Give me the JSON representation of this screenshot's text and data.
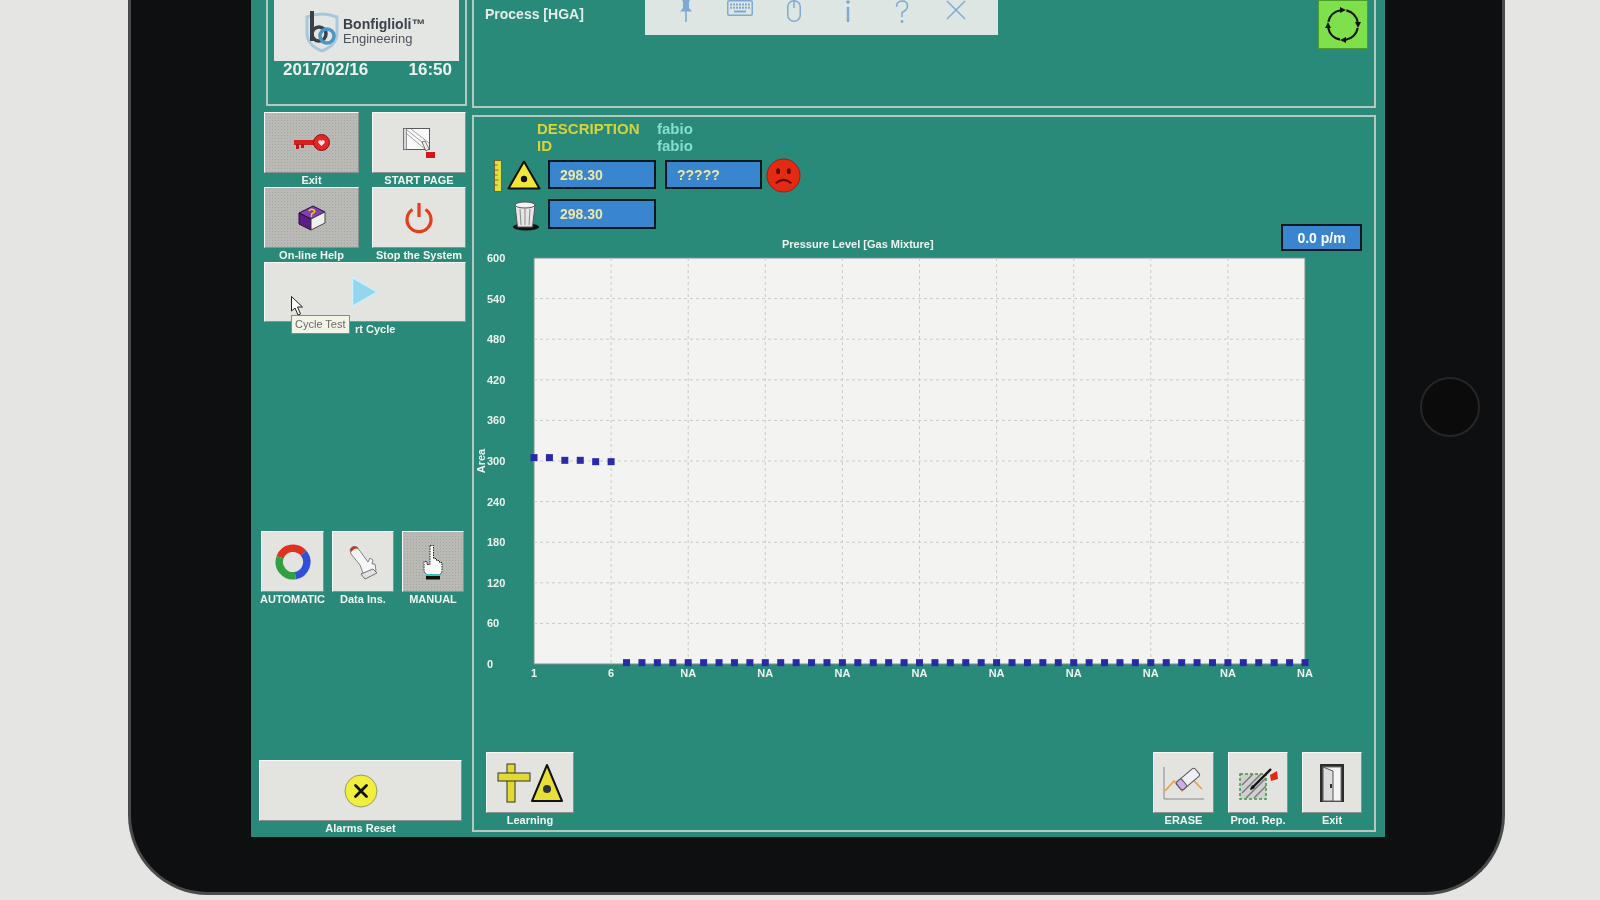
{
  "logo": {
    "name": "Bonfiglioli™",
    "subtitle": "Engineering"
  },
  "clock": {
    "date": "2017/02/16",
    "time": "16:50"
  },
  "menu": [
    {
      "kind": "tile",
      "label": "Exit",
      "disabled": true
    },
    {
      "kind": "tile",
      "label": "START PAGE",
      "disabled": false
    },
    {
      "kind": "tile",
      "label": "On-line Help",
      "disabled": true
    },
    {
      "kind": "tile",
      "label": "Stop the System",
      "disabled": false
    },
    {
      "kind": "wide",
      "label": "rt Cycle",
      "disabled": false,
      "tooltip": "Cycle Test"
    }
  ],
  "modes": [
    {
      "label": "AUTOMATIC",
      "selected": false
    },
    {
      "label": "Data Ins.",
      "selected": false
    },
    {
      "label": "MANUAL",
      "selected": true
    }
  ],
  "alarms_reset": {
    "label": "Alarms Reset"
  },
  "header": {
    "title": "Process [HGA]"
  },
  "description": [
    {
      "label": "DESCRIPTION",
      "value": "fabio"
    },
    {
      "label": "ID",
      "value": "fabio"
    }
  ],
  "measurements": [
    {
      "fields": [
        "298.30",
        "?????"
      ],
      "fault": true
    },
    {
      "fields": [
        "298.30"
      ]
    }
  ],
  "chart": {
    "readout": "0.0 p/m",
    "chart_data": {
      "type": "scatter",
      "title": "Pressure Level [Gas Mixture]",
      "ylabel": "Area",
      "grid": true,
      "x": [
        1,
        2,
        3,
        4,
        5,
        6,
        7,
        8,
        9,
        10,
        11,
        12,
        13,
        14,
        15,
        16,
        17,
        18,
        19,
        20,
        21,
        22,
        23,
        24,
        25,
        26,
        27,
        28,
        29,
        30,
        31,
        32,
        33,
        34,
        35,
        36,
        37,
        38,
        39,
        40,
        41,
        42,
        43,
        44,
        45,
        46,
        47,
        48,
        49,
        50,
        51
      ],
      "series": [
        {
          "color": "#2a2aa8",
          "values": [
            305,
            305,
            301,
            301,
            299,
            299,
            2,
            2,
            2,
            2,
            2,
            2,
            2,
            2,
            2,
            2,
            2,
            2,
            2,
            2,
            2,
            2,
            2,
            2,
            2,
            2,
            2,
            2,
            2,
            2,
            2,
            2,
            2,
            2,
            2,
            2,
            2,
            2,
            2,
            2,
            2,
            2,
            2,
            2,
            2,
            2,
            2,
            2,
            2,
            2,
            2
          ]
        }
      ],
      "xlim": [
        1,
        51
      ],
      "ylim": [
        0,
        600
      ],
      "xticks": [
        {
          "value": 1,
          "label": "1"
        },
        {
          "value": 6,
          "label": "6"
        },
        {
          "value": 11,
          "label": "NA"
        },
        {
          "value": 16,
          "label": "NA"
        },
        {
          "value": 21,
          "label": "NA"
        },
        {
          "value": 26,
          "label": "NA"
        },
        {
          "value": 31,
          "label": "NA"
        },
        {
          "value": 36,
          "label": "NA"
        },
        {
          "value": 41,
          "label": "NA"
        },
        {
          "value": 46,
          "label": "NA"
        },
        {
          "value": 51,
          "label": "NA"
        }
      ],
      "yticks": [
        0,
        60,
        120,
        180,
        240,
        300,
        360,
        420,
        480,
        540,
        600
      ]
    }
  },
  "actions_left": [
    {
      "label": "Learning"
    }
  ],
  "actions_right": [
    {
      "label": "ERASE"
    },
    {
      "label": "Prod. Rep."
    },
    {
      "label": "Exit"
    }
  ]
}
